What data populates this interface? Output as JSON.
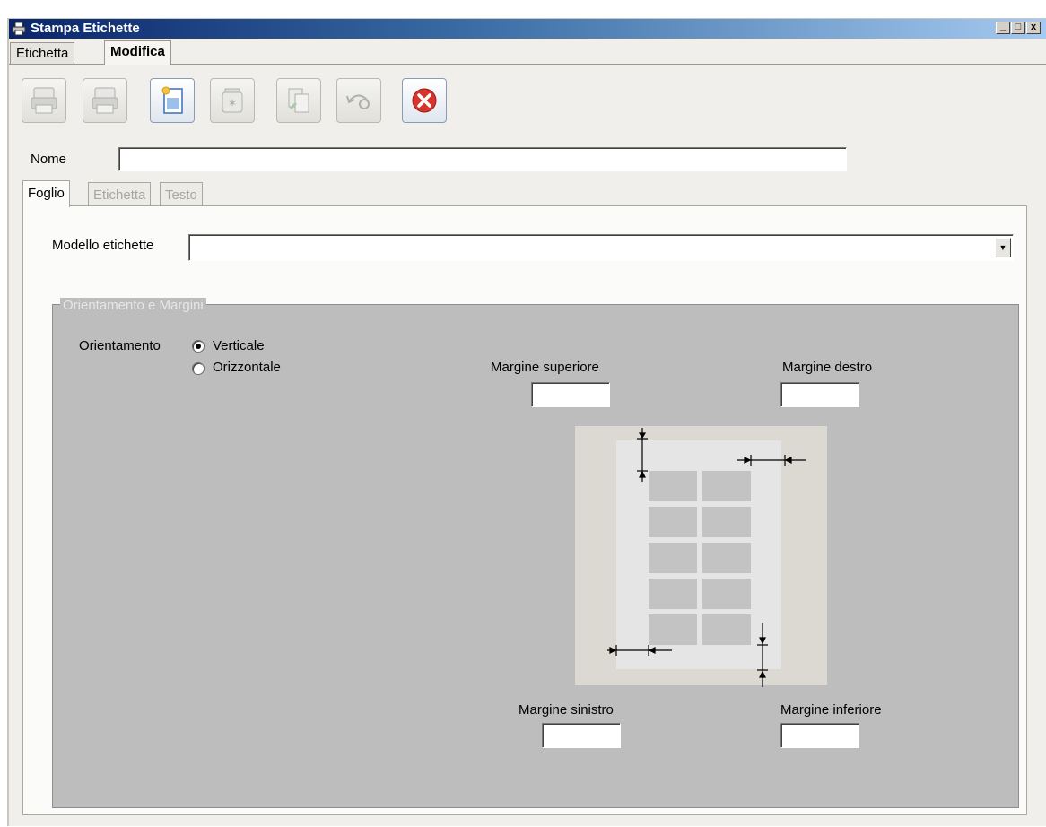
{
  "window": {
    "title": "Stampa Etichette",
    "controls": {
      "minimize": "_",
      "maximize": "□",
      "close": "x"
    }
  },
  "outer_tabs": [
    {
      "label": "Etichetta",
      "active": false
    },
    {
      "label": "Modifica",
      "active": true
    }
  ],
  "toolbar": [
    {
      "icon": "printer-icon",
      "enabled": false
    },
    {
      "icon": "printer-preview-icon",
      "enabled": false
    },
    {
      "icon": "new-document-icon",
      "enabled": true
    },
    {
      "icon": "delete-icon",
      "enabled": false
    },
    {
      "icon": "copy-icon",
      "enabled": false
    },
    {
      "icon": "undo-icon",
      "enabled": false
    },
    {
      "icon": "close-icon",
      "enabled": true
    }
  ],
  "form": {
    "nome_label": "Nome",
    "nome_value": ""
  },
  "inner_tabs": [
    {
      "label": "Foglio",
      "active": true
    },
    {
      "label": "Etichetta",
      "active": false
    },
    {
      "label": "Testo",
      "active": false
    }
  ],
  "foglio": {
    "modello_label": "Modello etichette",
    "modello_value": "",
    "group_title": "Orientamento e Margini",
    "orientamento_label": "Orientamento",
    "orientation_options": [
      {
        "label": "Verticale",
        "checked": true
      },
      {
        "label": "Orizzontale",
        "checked": false
      }
    ],
    "margine_superiore_label": "Margine superiore",
    "margine_superiore_value": "",
    "margine_destro_label": "Margine destro",
    "margine_destro_value": "",
    "margine_sinistro_label": "Margine sinistro",
    "margine_sinistro_value": "",
    "margine_inferiore_label": "Margine inferiore",
    "margine_inferiore_value": ""
  },
  "colors": {
    "titlebar_start": "#0a246a",
    "titlebar_end": "#a6caf0",
    "window_bg": "#f0efeb",
    "group_bg": "#bdbdbd",
    "diagram_sheet_bg": "#dcd8d2",
    "label_cell": "#c3c3c3",
    "close_red": "#d9342b"
  }
}
